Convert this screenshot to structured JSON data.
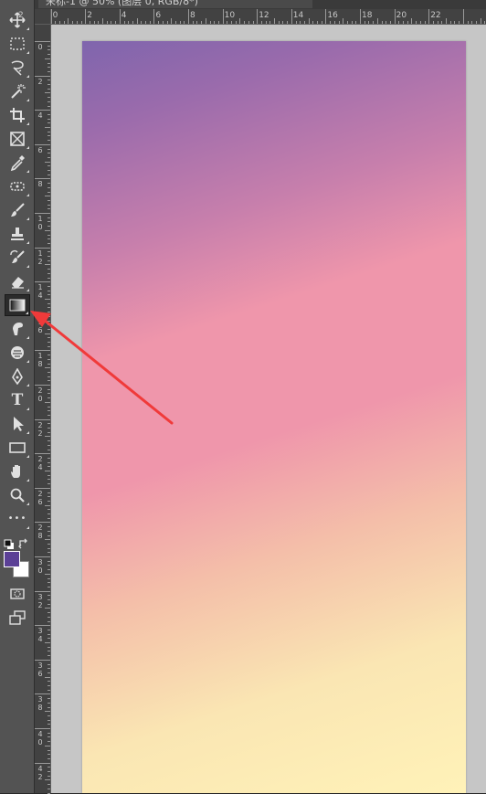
{
  "document_tab": {
    "title": "未标-1 @ 50% (图层 0, RGB/8*)"
  },
  "toolbar": {
    "tools": [
      {
        "icon": "move-icon"
      },
      {
        "icon": "rectangular-marquee-icon"
      },
      {
        "icon": "lasso-icon"
      },
      {
        "icon": "magic-wand-icon"
      },
      {
        "icon": "crop-icon"
      },
      {
        "icon": "frame-icon"
      },
      {
        "icon": "eyedropper-icon"
      },
      {
        "icon": "spot-healing-icon"
      },
      {
        "icon": "brush-icon"
      },
      {
        "icon": "clone-stamp-icon"
      },
      {
        "icon": "history-brush-icon"
      },
      {
        "icon": "eraser-icon"
      },
      {
        "icon": "gradient-icon",
        "active": true
      },
      {
        "icon": "smudge-icon"
      },
      {
        "icon": "dodge-icon"
      },
      {
        "icon": "pen-icon"
      },
      {
        "icon": "type-icon"
      },
      {
        "icon": "path-selection-icon"
      },
      {
        "icon": "rectangle-shape-icon"
      },
      {
        "icon": "hand-icon"
      },
      {
        "icon": "zoom-icon"
      },
      {
        "icon": "more-tools-icon"
      },
      {
        "icon": "quick-mask-icon"
      },
      {
        "icon": "screen-mode-icon"
      }
    ],
    "type_tool_glyph": "T",
    "more_glyph": "•••",
    "foreground_color": "#5b4096",
    "background_color": "#ffffff"
  },
  "ruler_top": {
    "labels": [
      "2",
      "0",
      "2",
      "4",
      "6",
      "8",
      "10",
      "12",
      "14",
      "16",
      "18",
      "20",
      "22"
    ]
  },
  "ruler_left": {
    "labels": [
      "0",
      "2",
      "4",
      "6",
      "8",
      "10",
      "12",
      "14",
      "16",
      "18",
      "20",
      "22",
      "24",
      "26",
      "28",
      "30",
      "32",
      "34",
      "36",
      "38",
      "40",
      "42"
    ]
  },
  "canvas": {
    "gradient_colors": [
      "#7f65ad",
      "#c77fac",
      "#ef96ab",
      "#f4bfa9",
      "#fff2b8"
    ]
  },
  "annotation": {
    "color": "#f03a3a"
  }
}
